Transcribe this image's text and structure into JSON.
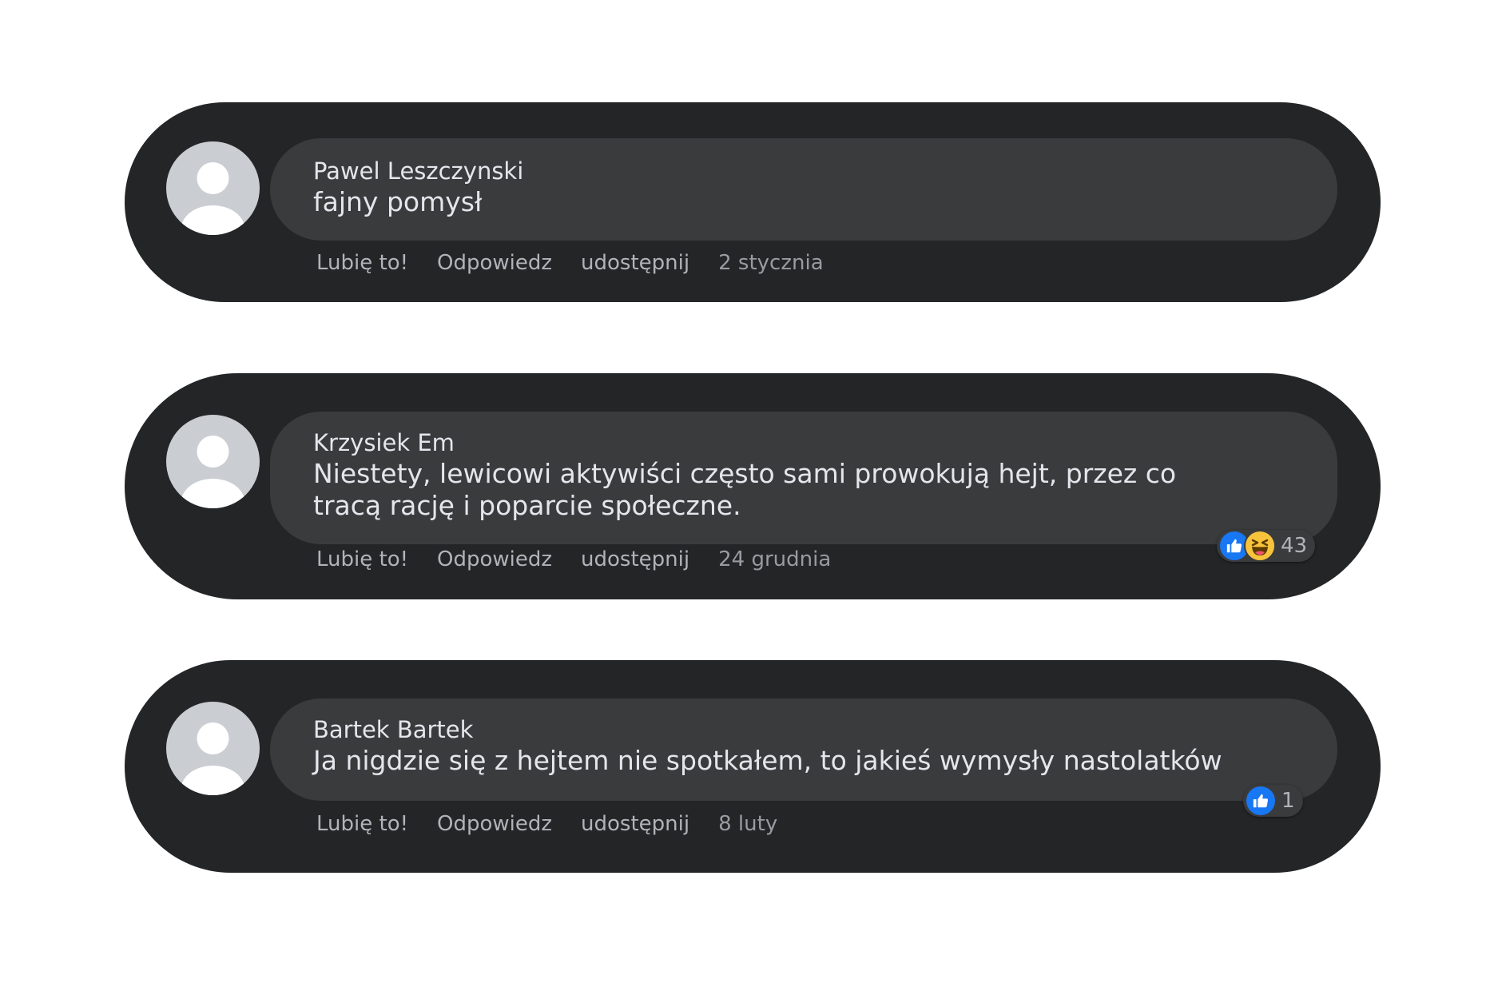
{
  "comments": [
    {
      "author": "Pawel Leszczynski",
      "text": "fajny pomysł",
      "actions": {
        "like": "Lubię to!",
        "reply": "Odpowiedz",
        "share": "udostępnij"
      },
      "date": "2 stycznia",
      "reactions": null
    },
    {
      "author": "Krzysiek Em",
      "text": "Niestety, lewicowi aktywiści często sami prowokują hejt, przez co tracą rację i poparcie społeczne.",
      "actions": {
        "like": "Lubię to!",
        "reply": "Odpowiedz",
        "share": "udostępnij"
      },
      "date": "24 grudnia",
      "reactions": {
        "icons": [
          "like-icon",
          "haha-icon"
        ],
        "count": "43"
      }
    },
    {
      "author": "Bartek Bartek",
      "text": "Ja nigdzie się z hejtem nie spotkałem, to jakieś wymysły nastolatków",
      "actions": {
        "like": "Lubię to!",
        "reply": "Odpowiedz",
        "share": "udostępnij"
      },
      "date": "8 luty",
      "reactions": {
        "icons": [
          "like-icon"
        ],
        "count": "1"
      }
    }
  ],
  "colors": {
    "page_background": "#ffffff",
    "card_background": "#232527",
    "bubble_background": "#3a3b3d",
    "text_primary": "#e4e6eb",
    "text_secondary": "#b0b3b8",
    "like_blue": "#1877f2",
    "haha_yellow": "#f7c33b",
    "avatar_grey": "#cacdd2"
  }
}
